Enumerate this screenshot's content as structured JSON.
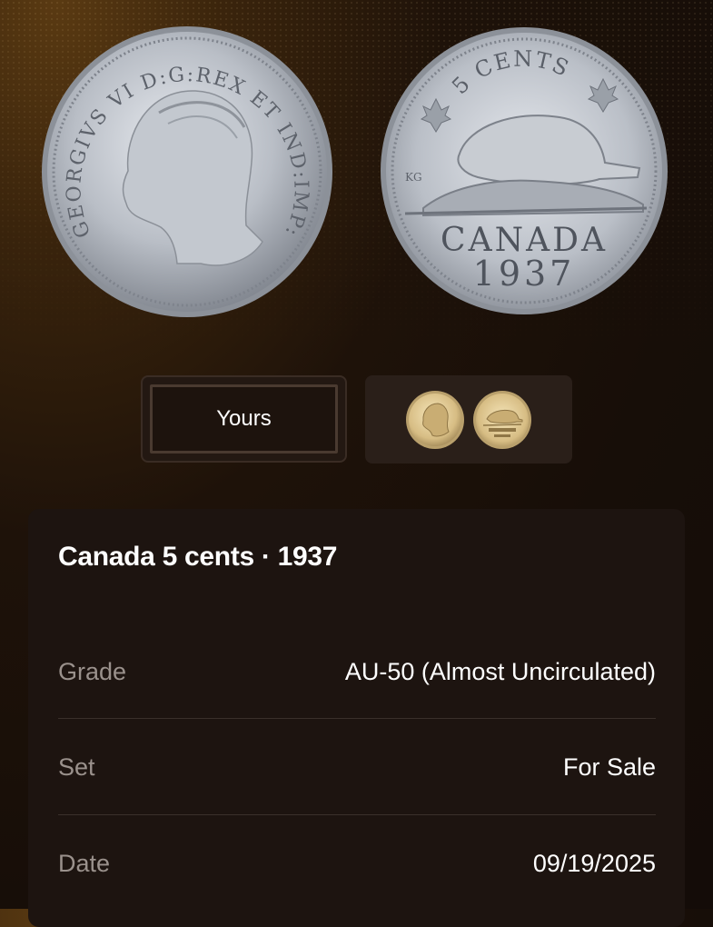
{
  "coin_images": {
    "obverse": {
      "icon": "coin-obverse-king-george-vi",
      "legend_top": "GEORGIVS VI D:G:REX ET IND:IMP:"
    },
    "reverse": {
      "icon": "coin-reverse-beaver",
      "denomination": "5 CENTS",
      "country": "CANADA",
      "year": "1937",
      "initials": "KG"
    }
  },
  "tabs": {
    "yours_label": "Yours",
    "reference_icon": "reference-coin-thumbnails"
  },
  "details": {
    "title": "Canada 5 cents · 1937",
    "rows": [
      {
        "label": "Grade",
        "value": "AU-50 (Almost Uncirculated)"
      },
      {
        "label": "Set",
        "value": "For Sale"
      },
      {
        "label": "Date",
        "value": "09/19/2025"
      }
    ]
  },
  "colors": {
    "background_dark": "#140c08",
    "card": "#1d1410",
    "label_gray": "#9a918c",
    "accent_glow": "#5a3a12"
  }
}
